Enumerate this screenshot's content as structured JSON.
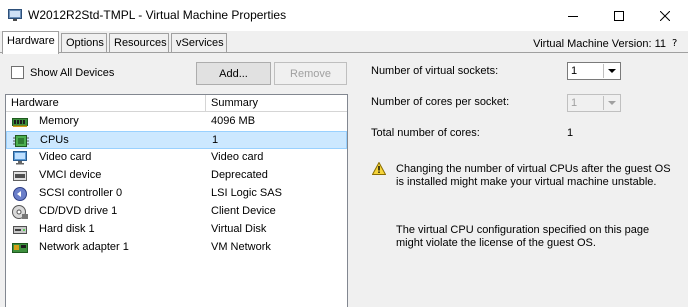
{
  "window": {
    "title": "W2012R2Std-TMPL - Virtual Machine Properties",
    "controls": [
      "minimize-icon",
      "maximize-icon",
      "close-icon"
    ]
  },
  "tabs": [
    {
      "label": "Hardware",
      "active": true
    },
    {
      "label": "Options",
      "active": false
    },
    {
      "label": "Resources",
      "active": false
    },
    {
      "label": "vServices",
      "active": false
    }
  ],
  "vm_version": "Virtual Machine Version: 11",
  "hardware": {
    "show_all_devices_label": "Show All Devices",
    "show_all_devices_checked": false,
    "add_button": "Add...",
    "remove_button": "Remove",
    "columns": [
      "Hardware",
      "Summary"
    ],
    "devices": [
      {
        "name": "Memory",
        "summary": "4096 MB",
        "icon": "memory-icon",
        "selected": false
      },
      {
        "name": "CPUs",
        "summary": "1",
        "icon": "cpu-icon",
        "selected": true
      },
      {
        "name": "Video card",
        "summary": "Video card",
        "icon": "monitor-icon",
        "selected": false
      },
      {
        "name": "VMCI device",
        "summary": "Deprecated",
        "icon": "vmci-icon",
        "selected": false
      },
      {
        "name": "SCSI controller 0",
        "summary": "LSI Logic SAS",
        "icon": "scsi-icon",
        "selected": false
      },
      {
        "name": "CD/DVD drive 1",
        "summary": "Client Device",
        "icon": "cd-dvd-icon",
        "selected": false
      },
      {
        "name": "Hard disk 1",
        "summary": "Virtual Disk",
        "icon": "hard-disk-icon",
        "selected": false
      },
      {
        "name": "Network adapter 1",
        "summary": "VM Network",
        "icon": "network-adapter-icon",
        "selected": false
      }
    ]
  },
  "cpu_settings": {
    "sockets_label": "Number of virtual sockets:",
    "sockets_value": "1",
    "cores_label": "Number of cores per socket:",
    "cores_value": "1",
    "total_label": "Total number of cores:",
    "total_value": "1",
    "warning_text": "Changing the number of virtual CPUs after the guest OS is installed might make your virtual machine unstable.",
    "license_text": "The virtual CPU configuration specified on this page might violate the license of the guest OS."
  },
  "colors": {
    "selection_bg": "#cce8ff",
    "selection_border": "#99d1ff",
    "warning_yellow": "#f5d43a"
  }
}
